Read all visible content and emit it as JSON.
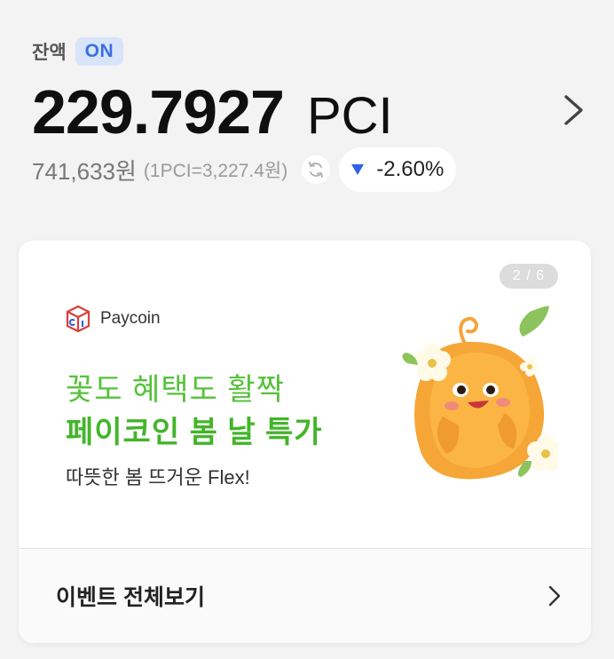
{
  "balance": {
    "label": "잔액",
    "status_badge": "ON",
    "amount": "229.7927",
    "unit": "PCI",
    "krw_value": "741,633원",
    "rate": "(1PCI=3,227.4원)",
    "change": "-2.60%",
    "change_direction": "down"
  },
  "event_banner": {
    "page_indicator": "2 / 6",
    "brand": "Paycoin",
    "headline_line1": "꽃도 혜택도 활짝",
    "headline_line2": "페이코인 봄 날 특가",
    "subtitle": "따뜻한 봄 뜨거운 Flex!"
  },
  "events_link": {
    "label": "이벤트 전체보기"
  },
  "colors": {
    "accent_blue": "#2f63e6",
    "badge_bg": "#d8e4f9",
    "green_headline": "#43b52a",
    "background": "#f3f3f3"
  },
  "icons": [
    "chevron-right-icon",
    "refresh-icon",
    "down-triangle-icon",
    "paycoin-logo-icon",
    "mascot-illustration"
  ]
}
